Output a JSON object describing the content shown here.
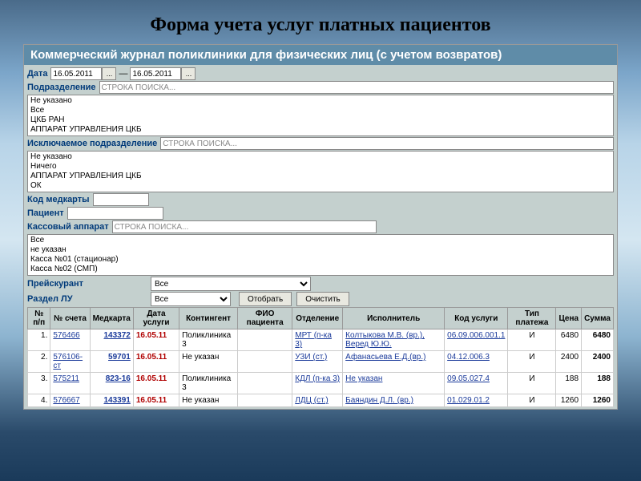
{
  "slide_title": "Форма учета услуг платных пациентов",
  "app_header": "Коммерческий журнал поликлиники для физических лиц (с учетом возвратов)",
  "labels": {
    "date": "Дата",
    "dept": "Подразделение",
    "excl_dept": "Исключаемое подразделение",
    "medcard": "Код медкарты",
    "patient": "Пациент",
    "cash": "Кассовый аппарат",
    "pricelist": "Прейскурант",
    "lu_section": "Раздел ЛУ"
  },
  "fields": {
    "date_from": "16.05.2011",
    "date_to": "16.05.2011",
    "search_placeholder": "СТРОКА ПОИСКА...",
    "dots": "...",
    "dept_options": [
      "Не указано",
      "Все",
      "ЦКБ РАН",
      "АППАРАТ УПРАВЛЕНИЯ ЦКБ"
    ],
    "excl_options": [
      "Не указано",
      "Ничего",
      "АППАРАТ УПРАВЛЕНИЯ ЦКБ",
      "   ОК"
    ],
    "cash_options": [
      "Все",
      "не указан",
      "Касса №01 (стационар)",
      "Касса №02 (СМП)"
    ],
    "pricelist_value": "Все",
    "lu_value": "Все"
  },
  "buttons": {
    "select": "Отобрать",
    "clear": "Очистить"
  },
  "table": {
    "headers": [
      "№ п/п",
      "№ счета",
      "Медкарта",
      "Дата услуги",
      "Контингент",
      "ФИО пациента",
      "Отделение",
      "Исполнитель",
      "Код услуги",
      "Тип платежа",
      "Цена",
      "Сумма"
    ],
    "rows": [
      {
        "n": "1.",
        "acct": "576466",
        "card": "143372",
        "date": "16.05.11",
        "cont": "Поликлиника 3",
        "fio": "",
        "dept": "МРТ (п-ка 3)",
        "exec": "Колтыкова М.В. (вр.), Веред Ю.Ю.",
        "code": "06.09.006.001.1",
        "ptype": "И",
        "price": "6480",
        "sum": "6480"
      },
      {
        "n": "2.",
        "acct": "576106-ст",
        "card": "59701",
        "date": "16.05.11",
        "cont": "Не указан",
        "fio": "",
        "dept": "УЗИ (ст.)",
        "exec": "Афанасьева Е.Д.(вр.)",
        "code": "04.12.006.3",
        "ptype": "И",
        "price": "2400",
        "sum": "2400"
      },
      {
        "n": "3.",
        "acct": "575211",
        "card": "823-16",
        "date": "16.05.11",
        "cont": "Поликлиника 3",
        "fio": "",
        "dept": "КДЛ (п-ка 3)",
        "exec": "Не указан",
        "code": "09.05.027.4",
        "ptype": "И",
        "price": "188",
        "sum": "188"
      },
      {
        "n": "4.",
        "acct": "576667",
        "card": "143391",
        "date": "16.05.11",
        "cont": "Не указан",
        "fio": "",
        "dept": "ЛДЦ (ст.)",
        "exec": "Баяндин Д.Л. (вр.)",
        "code": "01.029.01.2",
        "ptype": "И",
        "price": "1260",
        "sum": "1260"
      }
    ]
  }
}
